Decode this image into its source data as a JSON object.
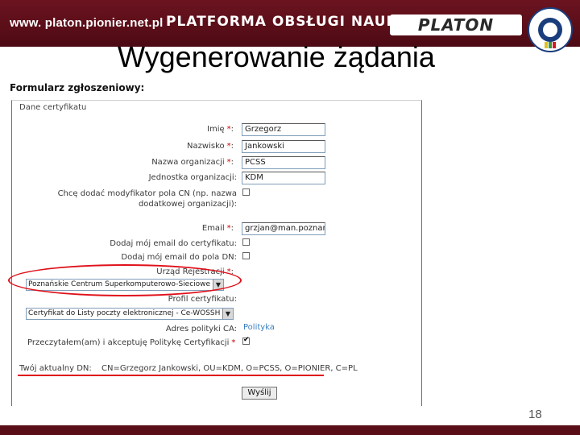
{
  "banner": {
    "url": "www. platon.pionier.net.pl",
    "platform": "PLATFORMA OBSŁUGI NAUKI",
    "logo": "PLATON",
    "seal_text": "POLSKI INTERNET OPTYCZNY"
  },
  "slide": {
    "title": "Wygenerowanie żądania",
    "form_caption": "Formularz zgłoszeniowy:",
    "page_number": "18"
  },
  "form": {
    "legend": "Dane certyfikatu",
    "fields": [
      {
        "label": "Imię",
        "value": "Grzegorz"
      },
      {
        "label": "Nazwisko",
        "value": "Jankowski"
      },
      {
        "label": "Nazwa organizacji",
        "value": "PCSS"
      },
      {
        "label": "Jednostka organizacji:",
        "value": "KDM"
      }
    ],
    "modifier_question_line1": "Chcę dodać modyfikator pola CN (np. nazwa",
    "modifier_question_line2": "dodatkowej organizacji):",
    "email_label": "Email",
    "email_value": "grzjan@man.poznan.pl",
    "add_email_cert_label": "Dodaj mój email do certyfikatu:",
    "add_email_dn_label": "Dodaj mój email do pola DN:",
    "ra_label": "Urząd Rejestracji",
    "ra_value": "Poznańskie Centrum Superkomputerowo-Sieciowe",
    "profile_label": "Profil certyfikatu:",
    "profile_value": "Certyfikat do Listy poczty elektronicznej - Ce-WOSSH",
    "policy_label": "Adres polityki CA:",
    "policy_link": "Polityka",
    "accept_label": "Przeczytałem(am) i akceptuję Politykę Certyfikacji",
    "required_mark": "*",
    "dn_label": "Twój aktualny DN:",
    "dn_value": "CN=Grzegorz Jankowski, OU=KDM, O=PCSS, O=PIONIER, C=PL",
    "submit_label": "Wyślij",
    "accept_checked": true
  },
  "colors": {
    "banner": "#5a0e18",
    "highlight": "#e0101a",
    "link": "#3a7fc0"
  }
}
